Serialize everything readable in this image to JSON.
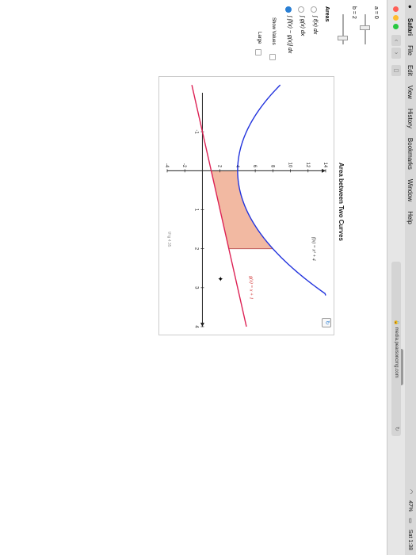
{
  "menubar": {
    "apple": "",
    "app": "Safari",
    "items": [
      "File",
      "Edit",
      "View",
      "History",
      "Bookmarks",
      "Window",
      "Help"
    ],
    "battery": "47%",
    "time": "Sat 1:38"
  },
  "browser": {
    "url": "media.pearsoncmg.com"
  },
  "controls": {
    "a_label": "a = 0",
    "b_label": "b = 2",
    "a_value": 0,
    "b_value": 2,
    "areas_heading": "Areas",
    "options": [
      "∫ f(x) dx",
      "∫ g(x) dx",
      "∫ [f(x) − g(x)] dx"
    ],
    "selected_option": 2,
    "show_values_label": "Show Values",
    "large_label": "Large"
  },
  "graph": {
    "title": "Area between Two Curves",
    "figure_label": "\\Fig 4.35",
    "f_label": "f(x) = x² + 4",
    "g_label": "g(x) = x + 1",
    "colors": {
      "f": "#2233dd",
      "g": "#dd2255",
      "shade": "#f2b9a2"
    }
  },
  "chart_data": {
    "type": "line",
    "title": "Area between Two Curves",
    "xlim": [
      -2,
      4
    ],
    "ylim": [
      -4,
      14
    ],
    "x_ticks": [
      -1,
      1,
      2,
      3,
      4
    ],
    "y_ticks": [
      -4,
      -2,
      2,
      4,
      6,
      8,
      10,
      12,
      14
    ],
    "series": [
      {
        "name": "f(x) = x² + 4",
        "x": [
          -2,
          -1,
          0,
          1,
          2,
          3
        ],
        "y": [
          8,
          5,
          4,
          5,
          8,
          13
        ]
      },
      {
        "name": "g(x) = x + 1",
        "x": [
          -2,
          0,
          2,
          4
        ],
        "y": [
          -1,
          1,
          3,
          5
        ]
      }
    ],
    "shaded_region": {
      "from": 0,
      "to": 2,
      "between": [
        "f(x) = x² + 4",
        "g(x) = x + 1"
      ]
    }
  }
}
